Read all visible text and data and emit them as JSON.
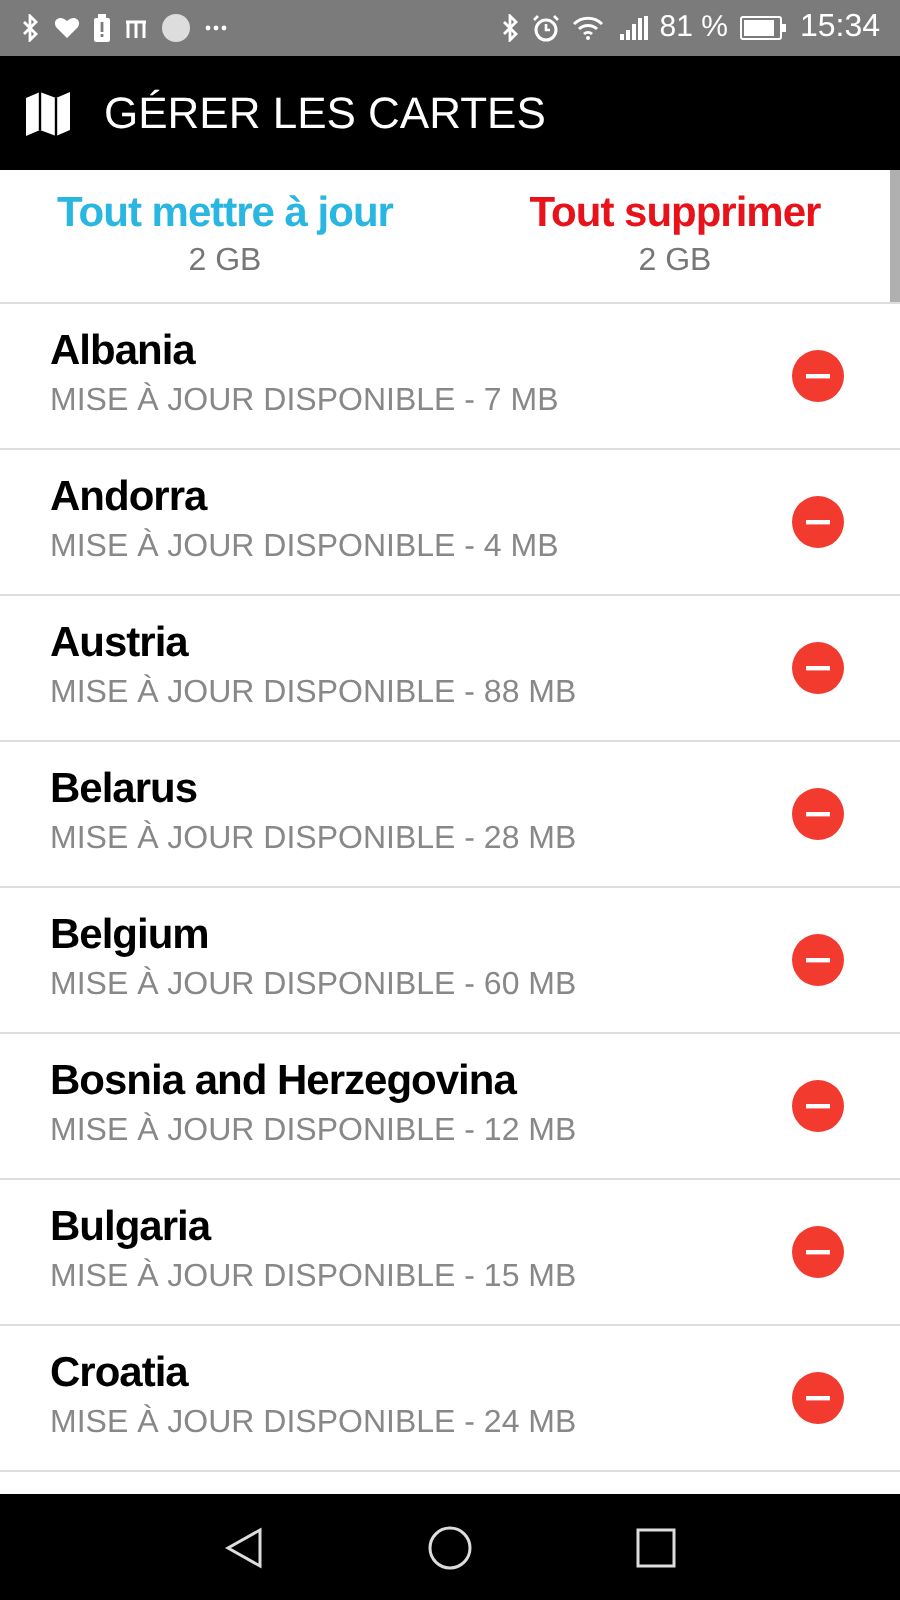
{
  "status_bar": {
    "battery": "81 %",
    "time": "15:34"
  },
  "header": {
    "title": "GÉRER LES CARTES"
  },
  "actions": [
    {
      "kind": "update",
      "label": "Tout mettre à jour",
      "size": "2 GB"
    },
    {
      "kind": "delete",
      "label": "Tout supprimer",
      "size": "2 GB"
    }
  ],
  "maps": [
    {
      "name": "Albania",
      "status": "MISE À JOUR DISPONIBLE - 7 MB"
    },
    {
      "name": "Andorra",
      "status": "MISE À JOUR DISPONIBLE - 4 MB"
    },
    {
      "name": "Austria",
      "status": "MISE À JOUR DISPONIBLE - 88 MB"
    },
    {
      "name": "Belarus",
      "status": "MISE À JOUR DISPONIBLE - 28 MB"
    },
    {
      "name": "Belgium",
      "status": "MISE À JOUR DISPONIBLE - 60 MB"
    },
    {
      "name": "Bosnia and Herzegovina",
      "status": "MISE À JOUR DISPONIBLE - 12 MB"
    },
    {
      "name": "Bulgaria",
      "status": "MISE À JOUR DISPONIBLE - 15 MB"
    },
    {
      "name": "Croatia",
      "status": "MISE À JOUR DISPONIBLE - 24 MB"
    }
  ]
}
